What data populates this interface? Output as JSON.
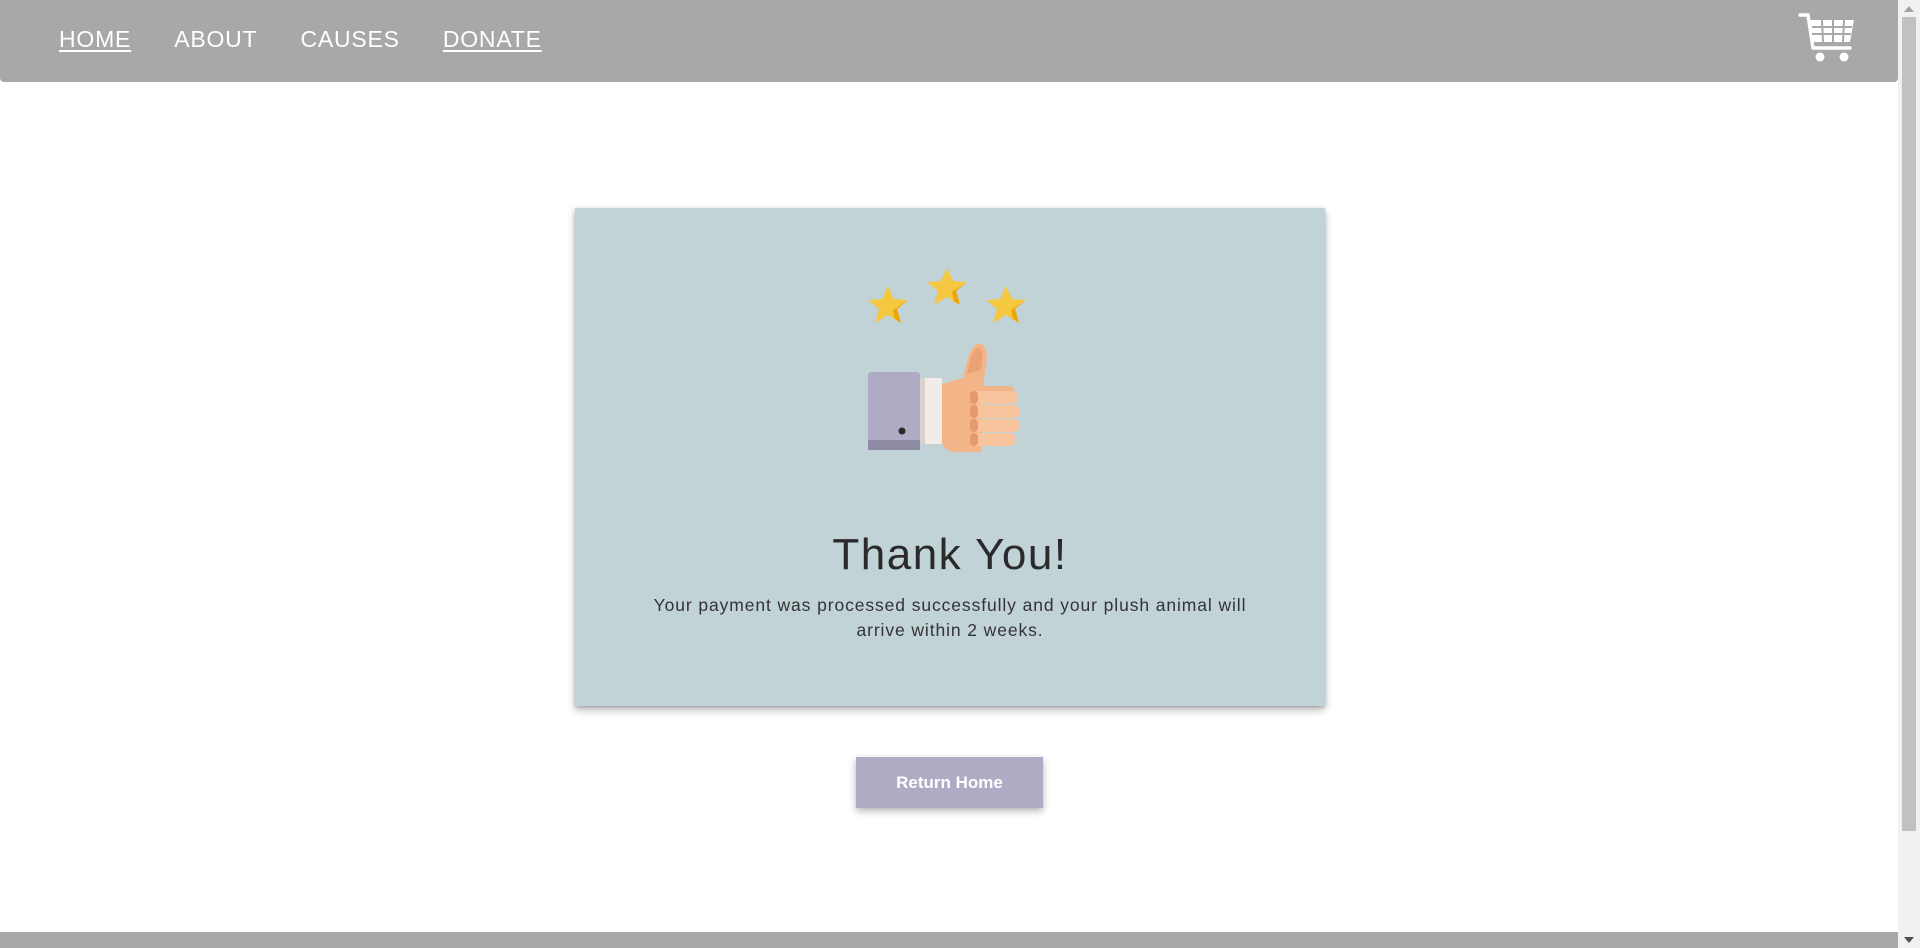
{
  "nav": {
    "items": [
      {
        "label": "HOME",
        "underlined": true
      },
      {
        "label": "ABOUT",
        "underlined": false
      },
      {
        "label": "CAUSES",
        "underlined": false
      },
      {
        "label": "DONATE",
        "underlined": true
      }
    ],
    "cart_icon": "shopping-cart-icon"
  },
  "card": {
    "illustration_icon": "thumbs-up-stars-icon",
    "title": "Thank You!",
    "message": "Your payment was processed successfully and your plush animal will arrive within 2 weeks."
  },
  "actions": {
    "return_label": "Return Home"
  },
  "colors": {
    "navbar": "#a8a8a8",
    "card_background": "#c2d3d8",
    "button": "#b0abc4",
    "star": "#f5c842",
    "star_shade": "#f0a500"
  }
}
